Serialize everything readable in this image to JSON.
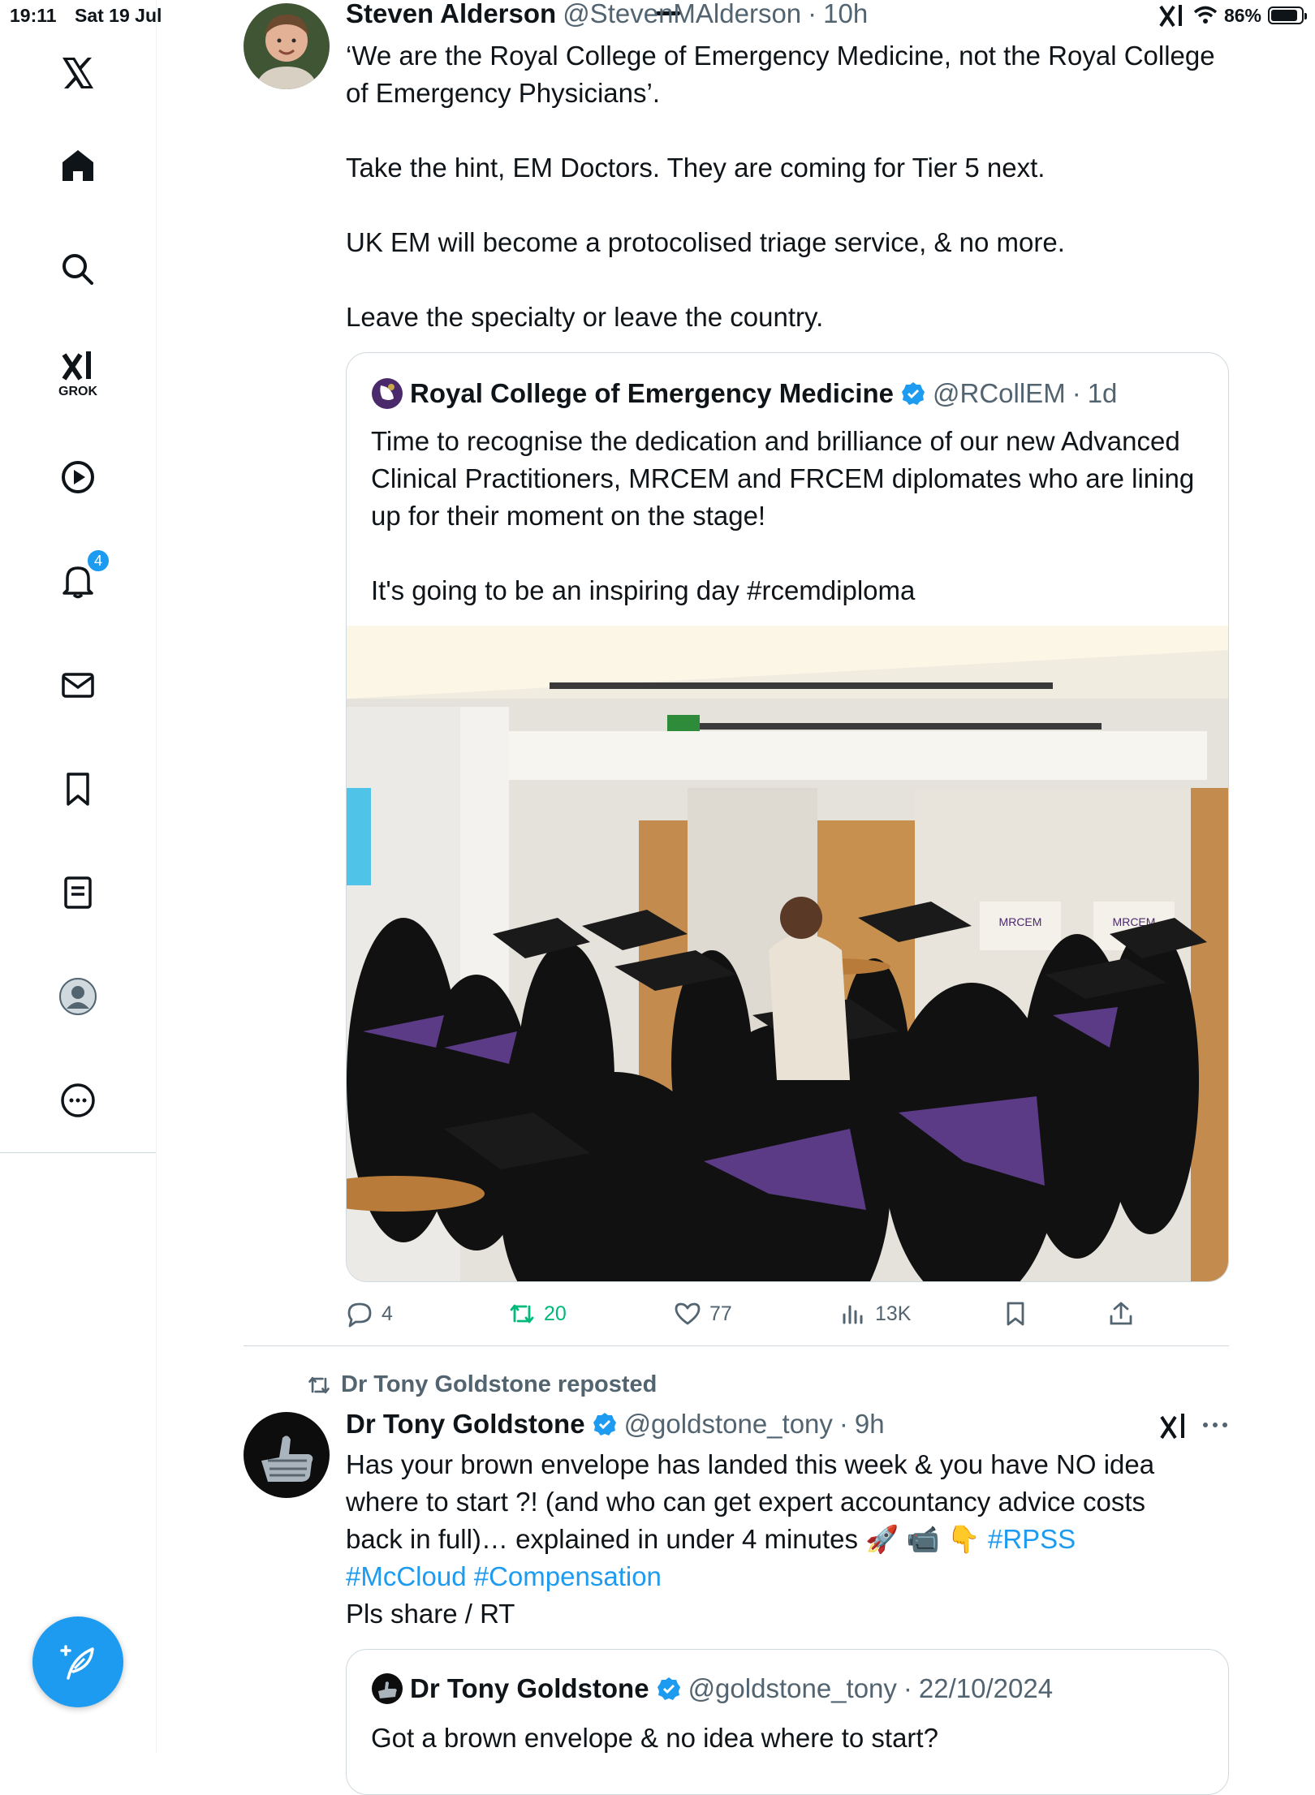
{
  "status_bar": {
    "time": "19:11",
    "date": "Sat 19 Jul",
    "battery": "86%"
  },
  "sidebar": {
    "items": [
      {
        "name": "x-logo"
      },
      {
        "name": "home"
      },
      {
        "name": "search"
      },
      {
        "name": "grok",
        "label": "GROK"
      },
      {
        "name": "videos"
      },
      {
        "name": "notifications",
        "badge": "4"
      },
      {
        "name": "messages"
      },
      {
        "name": "bookmarks"
      },
      {
        "name": "lists"
      },
      {
        "name": "profile"
      },
      {
        "name": "more"
      }
    ]
  },
  "tweet1": {
    "author_name": "Steven Alderson",
    "author_handle": "@StevenMAlderson",
    "time": "10h",
    "paragraphs": [
      "‘We are the Royal College of Emergency Medicine, not the Royal College of Emergency Physicians’.",
      "Take the hint, EM Doctors. They are coming for Tier 5 next.",
      "UK EM will become a protocolised triage service, & no more.",
      "Leave the specialty or leave the country."
    ],
    "quote": {
      "author_name": "Royal College of Emergency Medicine",
      "author_handle": "@RCollEM",
      "time": "1d",
      "paragraphs": [
        "Time to recognise the dedication and brilliance of our new Advanced Clinical Practitioners, MRCEM and FRCEM diplomates who are lining up for their moment on the stage!",
        "It's going to be an inspiring day #rcemdiploma"
      ],
      "photo_sign_1": "MRCEM",
      "photo_sign_2": "MRCEM"
    },
    "actions": {
      "replies": "4",
      "reposts": "20",
      "likes": "77",
      "views": "13K"
    }
  },
  "tweet2": {
    "repost_label": "Dr Tony Goldstone reposted",
    "author_name": "Dr Tony Goldstone",
    "author_handle": "@goldstone_tony",
    "time": "9h",
    "text_line1": "Has your brown envelope has landed this week & you have NO idea",
    "text_line2": "where to start ?! (and who can get expert accountancy advice costs",
    "text_line3": "back in full)… explained in under 4 minutes 🚀 📹 👇",
    "hashtag_1": "#RPSS",
    "hashtag_2": "#McCloud",
    "hashtag_3": "#Compensation",
    "text_line5": "Pls share / RT",
    "quote": {
      "author_name": "Dr Tony Goldstone",
      "author_handle": "@goldstone_tony",
      "date": "22/10/2024",
      "text": "Got a brown envelope & no idea where to start?"
    }
  },
  "colors": {
    "accent": "#1d9bf0",
    "repost_green": "#00ba7c",
    "text_secondary": "#536471"
  }
}
